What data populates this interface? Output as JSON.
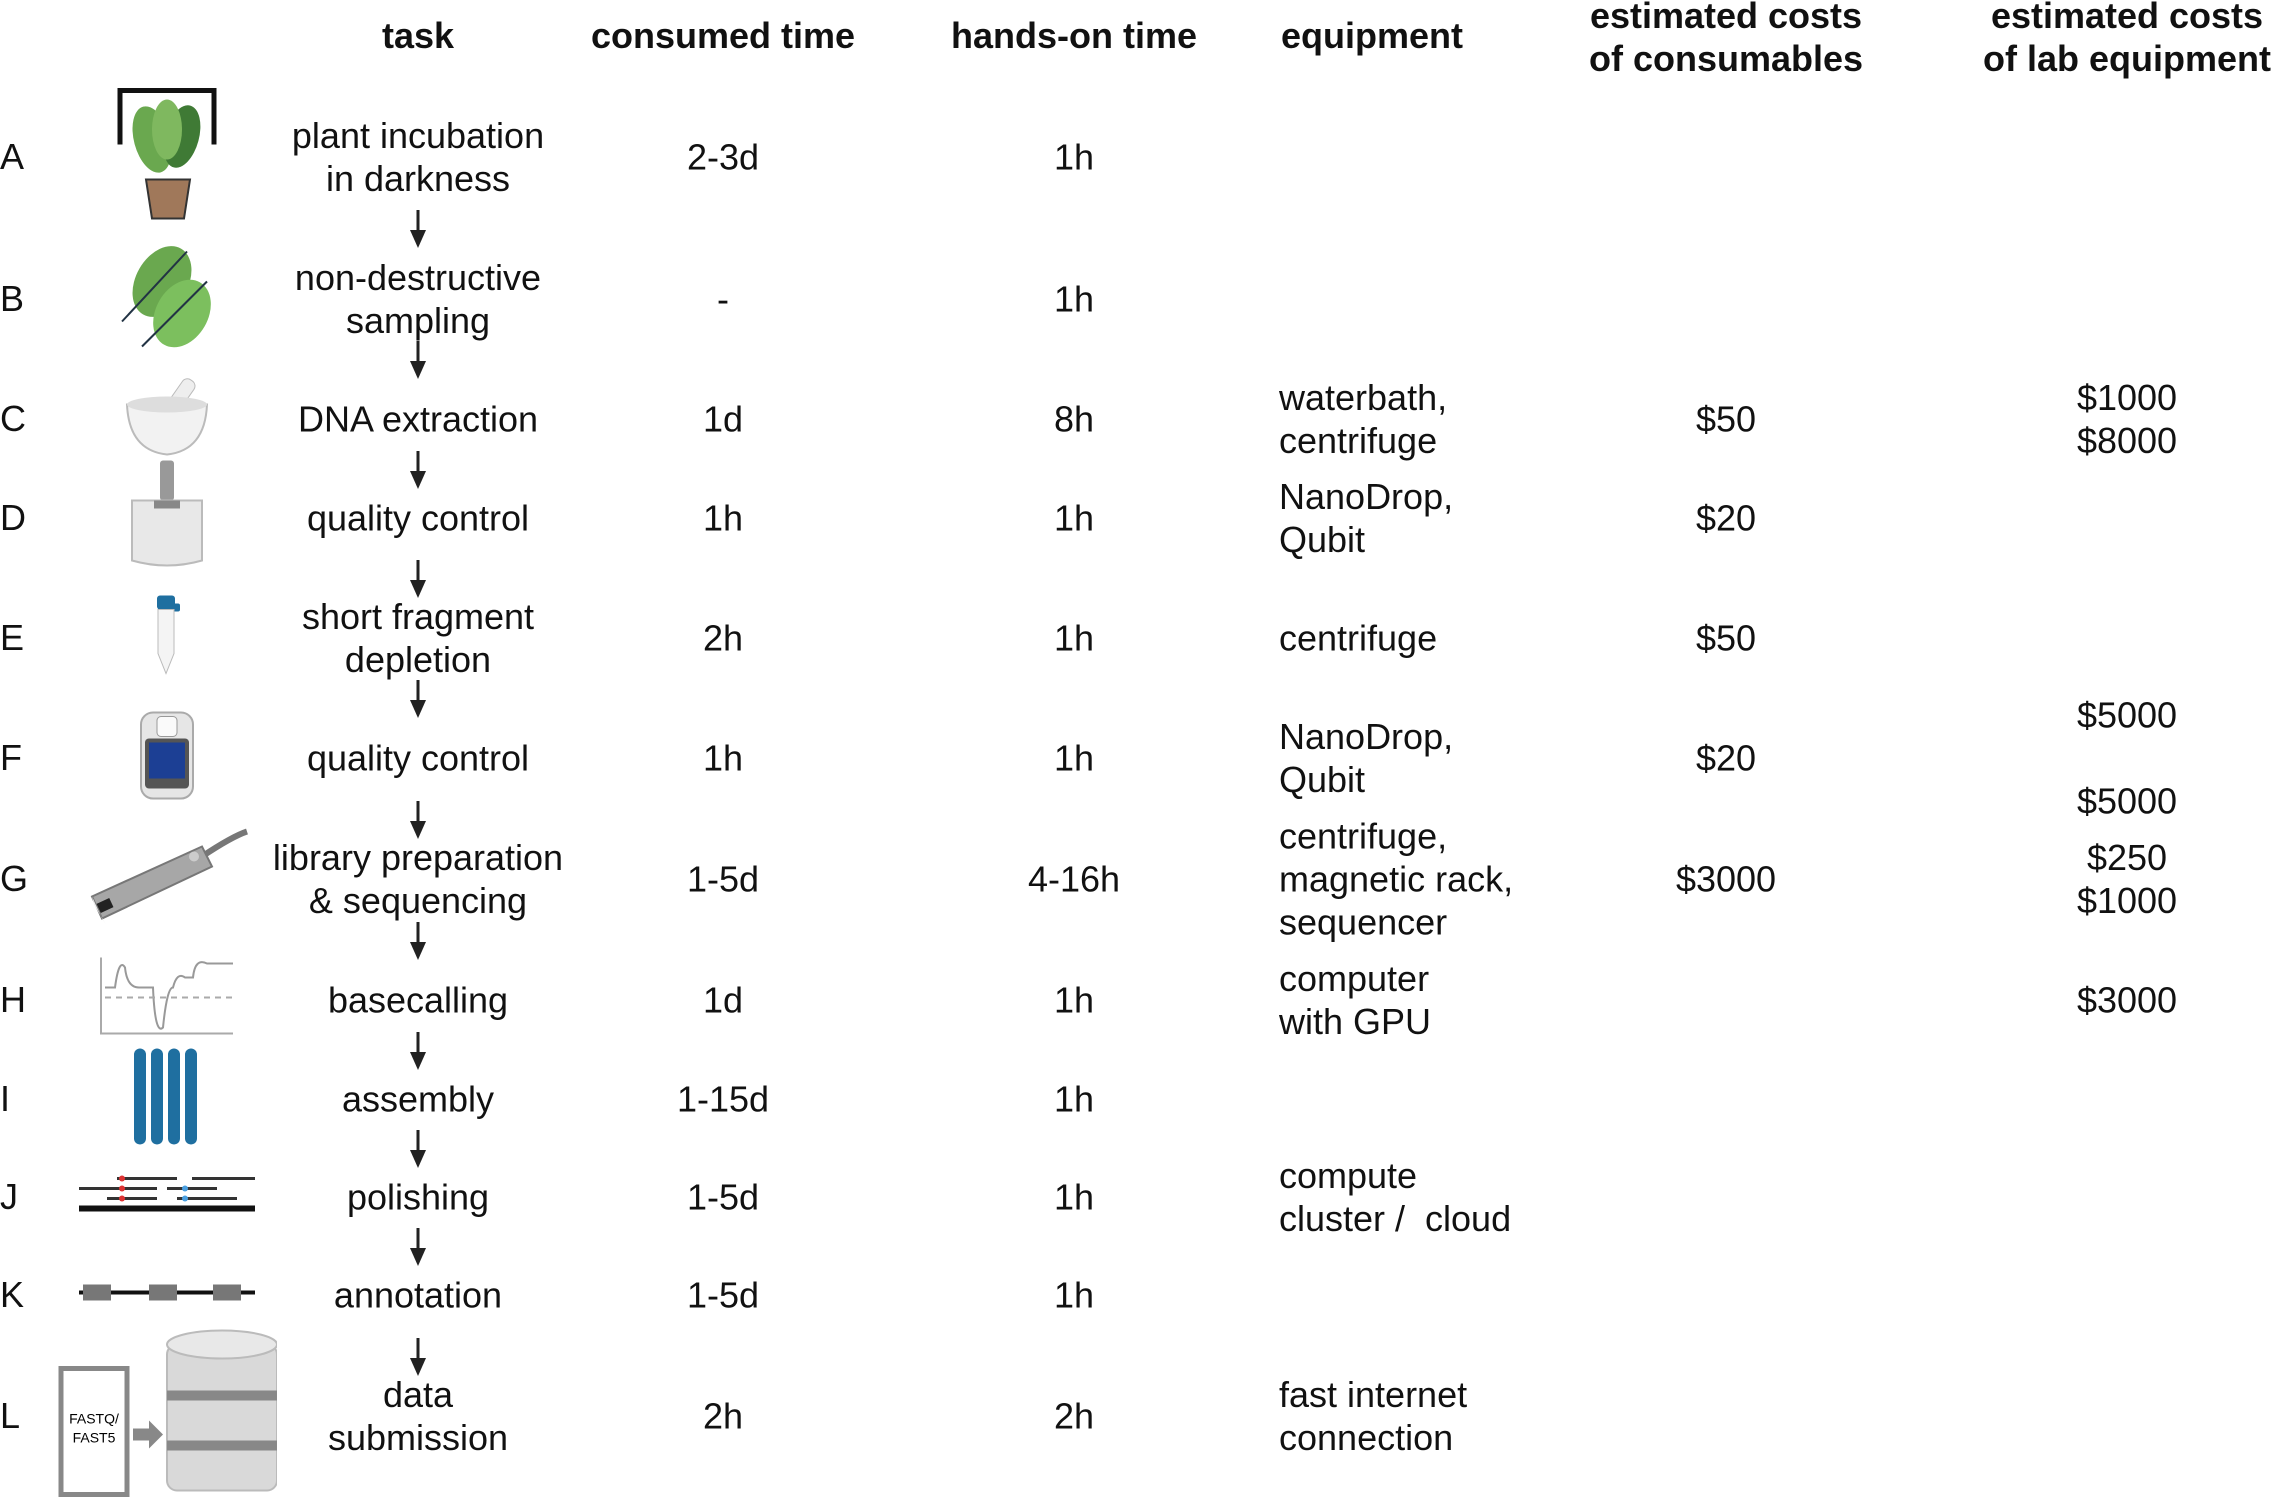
{
  "headers": {
    "task": "task",
    "consumed_time": "consumed time",
    "hands_on_time": "hands-on time",
    "equipment": "equipment",
    "costs_consumables": "estimated costs\nof consumables",
    "costs_lab_equipment": "estimated costs\nof lab equipment"
  },
  "rows": [
    {
      "letter": "A",
      "icon": "plant-in-dark-box-icon",
      "task": "plant incubation\nin darkness",
      "consumed": "2-3d",
      "hands_on": "1h",
      "equipment": "",
      "consumables": "",
      "lab": ""
    },
    {
      "letter": "B",
      "icon": "leaves-icon",
      "task": "non-destructive\nsampling",
      "consumed": "-",
      "hands_on": "1h",
      "equipment": "",
      "consumables": "",
      "lab": ""
    },
    {
      "letter": "C",
      "icon": "mortar-pestle-icon",
      "task": "DNA extraction",
      "consumed": "1d",
      "hands_on": "8h",
      "equipment": "waterbath,\ncentrifuge",
      "consumables": "$50",
      "lab": "$1000\n$8000"
    },
    {
      "letter": "D",
      "icon": "nanodrop-icon",
      "task": "quality control",
      "consumed": "1h",
      "hands_on": "1h",
      "equipment": "NanoDrop,\nQubit",
      "consumables": "$20",
      "lab": ""
    },
    {
      "letter": "E",
      "icon": "tube-icon",
      "task": "short fragment\ndepletion",
      "consumed": "2h",
      "hands_on": "1h",
      "equipment": "centrifuge",
      "consumables": "$50",
      "lab": ""
    },
    {
      "letter": "F",
      "icon": "qubit-icon",
      "task": "quality control",
      "consumed": "1h",
      "hands_on": "1h",
      "equipment": "NanoDrop,\nQubit",
      "consumables": "$20",
      "lab": "$5000\n\n$5000"
    },
    {
      "letter": "G",
      "icon": "minion-sequencer-icon",
      "task": "library preparation\n& sequencing",
      "consumed": "1-5d",
      "hands_on": "4-16h",
      "equipment": "centrifuge,\nmagnetic rack,\nsequencer",
      "consumables": "$3000",
      "lab": "$250\n$1000"
    },
    {
      "letter": "H",
      "icon": "signal-trace-icon",
      "task": "basecalling",
      "consumed": "1d",
      "hands_on": "1h",
      "equipment": "computer\nwith GPU",
      "consumables": "",
      "lab": "$3000"
    },
    {
      "letter": "I",
      "icon": "chromosomes-icon",
      "task": "assembly",
      "consumed": "1-15d",
      "hands_on": "1h",
      "equipment": "",
      "consumables": "",
      "lab": ""
    },
    {
      "letter": "J",
      "icon": "read-alignment-icon",
      "task": "polishing",
      "consumed": "1-5d",
      "hands_on": "1h",
      "equipment": "compute\ncluster /  cloud",
      "consumables": "",
      "lab": ""
    },
    {
      "letter": "K",
      "icon": "gene-model-icon",
      "task": "annotation",
      "consumed": "1-5d",
      "hands_on": "1h",
      "equipment": "",
      "consumables": "",
      "lab": ""
    },
    {
      "letter": "L",
      "icon": "database-upload-icon",
      "task": "data\nsubmission",
      "consumed": "2h",
      "hands_on": "2h",
      "equipment": "fast internet\nconnection",
      "consumables": "",
      "lab": ""
    }
  ],
  "file_label": "FASTQ/\nFAST5",
  "colors": {
    "leaf": "#6aa84f",
    "leaf_dark": "#3f7a35",
    "pot": "#a0785a",
    "blue": "#1f6fa0",
    "screen": "#1c3f94",
    "grey": "#a9a9a9",
    "red": "#d33",
    "lightblue": "#4a9fe0"
  }
}
